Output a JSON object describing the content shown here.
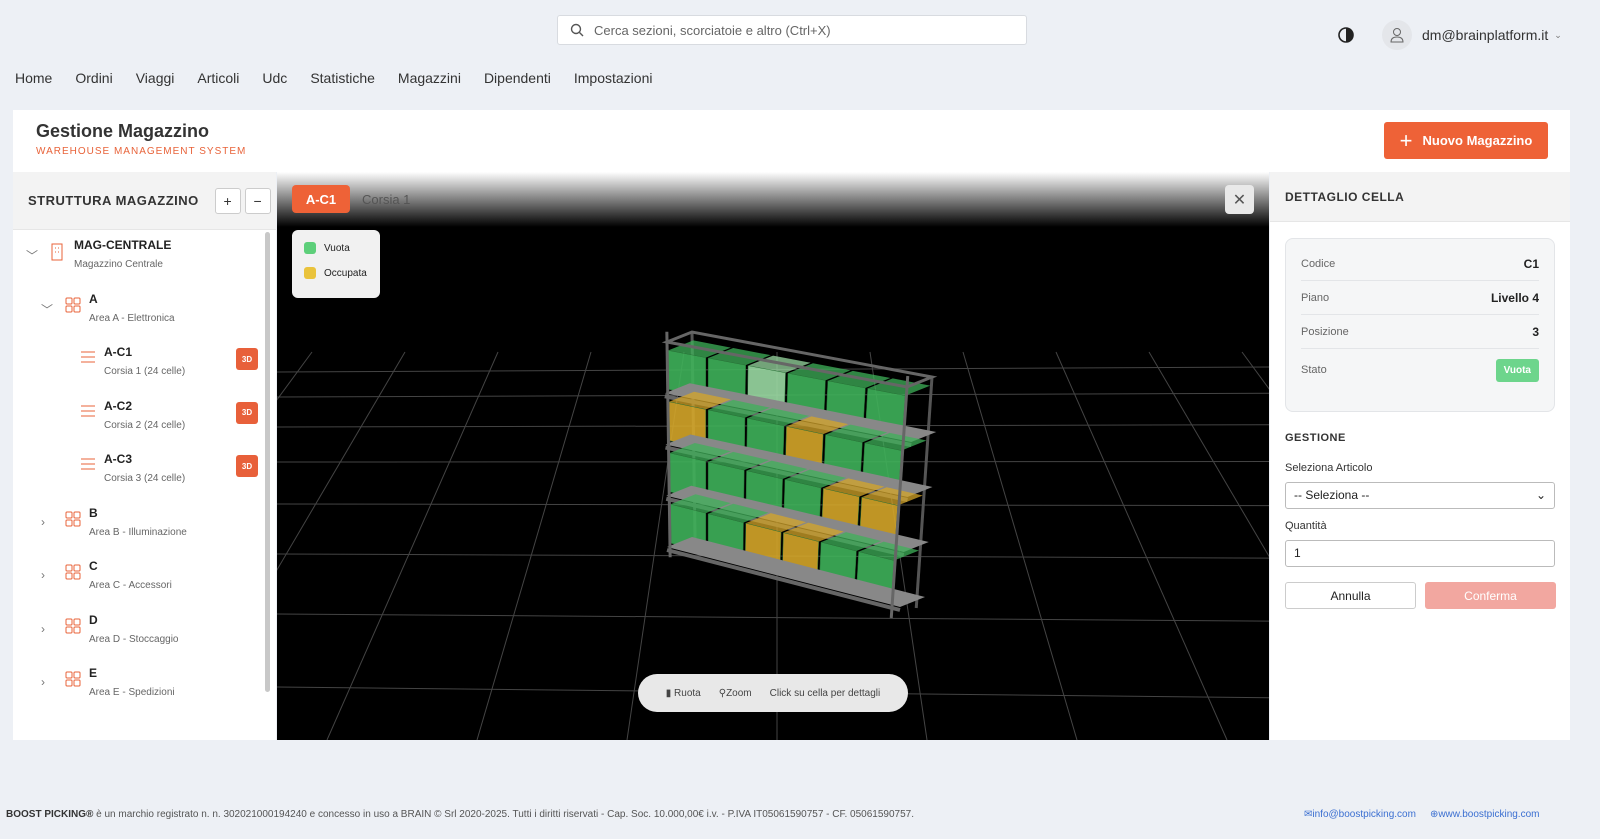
{
  "topbar": {
    "search_placeholder": "Cerca sezioni, scorciatoie e altro (Ctrl+X)",
    "user_email": "dm@brainplatform.it"
  },
  "nav": [
    "Home",
    "Ordini",
    "Viaggi",
    "Articoli",
    "Udc",
    "Statistiche",
    "Magazzini",
    "Dipendenti",
    "Impostazioni"
  ],
  "header": {
    "title": "Gestione Magazzino",
    "subtitle": "WAREHOUSE MANAGEMENT SYSTEM",
    "new_button": "Nuovo Magazzino"
  },
  "sidebar": {
    "title": "STRUTTURA MAGAZZINO",
    "expand": "+",
    "collapse": "−",
    "root": {
      "code": "MAG-CENTRALE",
      "name": "Magazzino Centrale"
    },
    "areas": [
      {
        "code": "A",
        "name": "Area A - Elettronica",
        "aisles": [
          {
            "code": "A-C1",
            "name": "Corsia 1 (24 celle)",
            "badge": "3D"
          },
          {
            "code": "A-C2",
            "name": "Corsia 2 (24 celle)",
            "badge": "3D"
          },
          {
            "code": "A-C3",
            "name": "Corsia 3 (24 celle)",
            "badge": "3D"
          }
        ]
      },
      {
        "code": "B",
        "name": "Area B - Illuminazione"
      },
      {
        "code": "C",
        "name": "Area C - Accessori"
      },
      {
        "code": "D",
        "name": "Area D - Stoccaggio"
      },
      {
        "code": "E",
        "name": "Area E - Spedizioni"
      }
    ]
  },
  "viewer": {
    "tag": "A-C1",
    "aisle": "Corsia 1",
    "legend": {
      "empty": "Vuota",
      "occupied": "Occupata"
    },
    "hint": {
      "rotate": "Ruota",
      "zoom": "Zoom",
      "click": "Click su cella per dettagli"
    },
    "colors": {
      "empty": "#3fb25a",
      "occupied": "#d4a62a",
      "selected": "#9ad9a2"
    },
    "levels": [
      [
        "E",
        "E",
        "S",
        "E",
        "E",
        "E"
      ],
      [
        "O",
        "E",
        "E",
        "O",
        "E",
        "E"
      ],
      [
        "E",
        "E",
        "E",
        "E",
        "O",
        "O"
      ],
      [
        "E",
        "E",
        "O",
        "O",
        "E",
        "E"
      ]
    ]
  },
  "detail": {
    "title": "DETTAGLIO CELLA",
    "rows": [
      {
        "k": "Codice",
        "v": "C1"
      },
      {
        "k": "Piano",
        "v": "Livello 4"
      },
      {
        "k": "Posizione",
        "v": "3"
      }
    ],
    "state_label": "Stato",
    "state": "Vuota",
    "gestione": "GESTIONE",
    "article_label": "Seleziona Articolo",
    "article_value": "-- Seleziona --",
    "qty_label": "Quantità",
    "qty_value": "1",
    "cancel": "Annulla",
    "confirm": "Conferma"
  },
  "footer": {
    "brand": "BOOST PICKING®",
    "text": " è un marchio registrato n. n. 302021000194240 e concesso in uso a BRAIN © Srl 2020-2025. Tutti i diritti riservati - Cap. Soc. 10.000,00€ i.v. - P.IVA IT05061590757 - CF. 05061590757.",
    "email": "info@boostpicking.com",
    "web": "www.boostpicking.com"
  }
}
